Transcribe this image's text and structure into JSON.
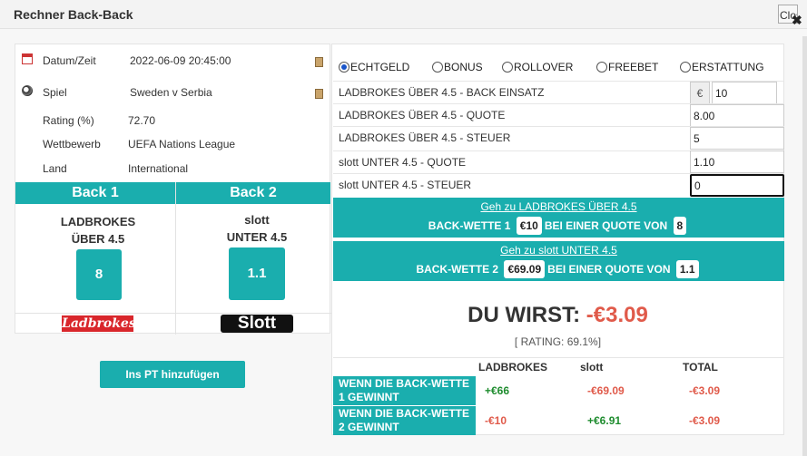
{
  "title": "Rechner Back-Back",
  "close_label": "Close",
  "info": {
    "datum_label": "Datum/Zeit",
    "datum_value": "2022-06-09 20:45:00",
    "spiel_label": "Spiel",
    "spiel_value": "Sweden v Serbia",
    "rating_label": "Rating (%)",
    "rating_value": "72.70",
    "wettbewerb_label": "Wettbewerb",
    "wettbewerb_value": "UEFA Nations League",
    "land_label": "Land",
    "land_value": "International"
  },
  "back1": {
    "header": "Back 1",
    "bookmaker": "LADBROKES",
    "market": "ÜBER 4.5",
    "odds": "8",
    "logo": "Ladbrokes"
  },
  "back2": {
    "header": "Back 2",
    "bookmaker": "slott",
    "market": "UNTER 4.5",
    "odds": "1.1",
    "logo": "Slott"
  },
  "pt_button": "Ins PT hinzufügen",
  "radios": [
    {
      "label": "ECHTGELD",
      "selected": true
    },
    {
      "label": "BONUS",
      "selected": false
    },
    {
      "label": "ROLLOVER",
      "selected": false
    },
    {
      "label": "FREEBET",
      "selected": false
    },
    {
      "label": "ERSTATTUNG",
      "selected": false
    }
  ],
  "currency": "€",
  "fields": [
    {
      "label": "LADBROKES ÜBER 4.5 - BACK EINSATZ",
      "value": "10"
    },
    {
      "label": "LADBROKES ÜBER 4.5 - QUOTE",
      "value": "8.00"
    },
    {
      "label": "LADBROKES ÜBER 4.5 - STEUER",
      "value": "5"
    },
    {
      "label": "slott UNTER 4.5  - QUOTE",
      "value": "1.10"
    },
    {
      "label": "slott UNTER 4.5 - STEUER",
      "value": "0"
    }
  ],
  "banner1": {
    "link": "Geh zu LADBROKES ÜBER 4.5",
    "prefix": "BACK-WETTE 1",
    "stake": "€10",
    "mid": "BEI EINER QUOTE VON",
    "odds": "8"
  },
  "banner2": {
    "link": "Geh zu slott UNTER 4.5",
    "prefix": "BACK-WETTE 2",
    "stake": "€69.09",
    "mid": "BEI EINER QUOTE VON",
    "odds": "1.1"
  },
  "result": {
    "prefix": "DU WIRST:",
    "amount": "-€3.09",
    "rating": "[ RATING: 69.1%]"
  },
  "table": {
    "headers": [
      "LADBROKES",
      "slott",
      "TOTAL"
    ],
    "rows": [
      {
        "label": "WENN DIE BACK-WETTE 1 GEWINNT",
        "values": [
          "+€66",
          "-€69.09",
          "-€3.09"
        ]
      },
      {
        "label": "WENN DIE BACK-WETTE 2 GEWINNT",
        "values": [
          "-€10",
          "+€6.91",
          "-€3.09"
        ]
      }
    ]
  }
}
